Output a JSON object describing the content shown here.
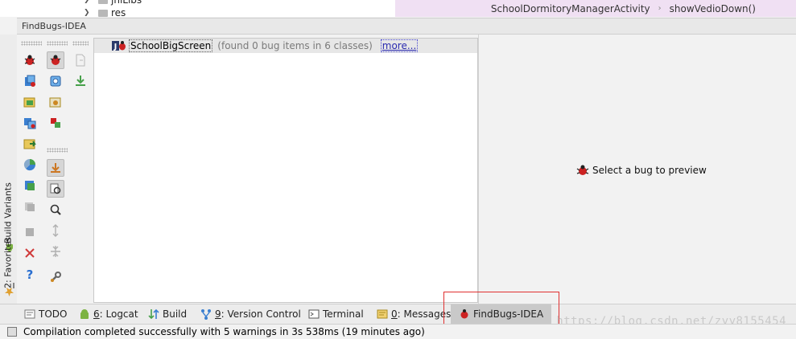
{
  "project_tree": {
    "items": [
      {
        "label": "jniLibs"
      },
      {
        "label": "res"
      }
    ]
  },
  "editor": {
    "breadcrumb": [
      "SchoolDormitoryManagerActivity",
      "showVedioDown()"
    ]
  },
  "tool_window": {
    "title": "FindBugs-IDEA",
    "tree": {
      "root_name": "SchoolBigScreen",
      "summary": "(found 0 bug items in 6 classes)",
      "more_link": "more..."
    },
    "preview": {
      "message": "Select a bug to preview"
    }
  },
  "left_stripe": {
    "build_variants": "Build Variants",
    "favorites_num": "2",
    "favorites_label": ": Favorites"
  },
  "bottom_tabs": {
    "todo": "TODO",
    "logcat_num": "6",
    "logcat_label": ": Logcat",
    "build": "Build",
    "vc_num": "9",
    "vc_label": ": Version Control",
    "terminal": "Terminal",
    "messages_num": "0",
    "messages_label": ": Messages",
    "findbugs": "FindBugs-IDEA"
  },
  "status": {
    "message": "Compilation completed successfully with 5 warnings in 3s 538ms (19 minutes ago)"
  },
  "watermark": "https://blog.csdn.net/zyy8155454",
  "colors": {
    "breadcrumb_bg": "#f0e0f3",
    "highlight_border": "#e03030",
    "bug_red": "#cc2222",
    "link_blue": "#2a2ab0"
  }
}
